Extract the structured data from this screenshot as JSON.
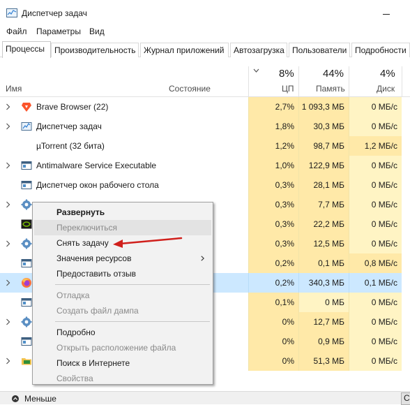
{
  "window": {
    "title": "Диспетчер задач"
  },
  "menu": [
    "Файл",
    "Параметры",
    "Вид"
  ],
  "tabs": [
    "Процессы",
    "Производительность",
    "Журнал приложений",
    "Автозагрузка",
    "Пользователи",
    "Подробности"
  ],
  "active_tab_index": 0,
  "header": {
    "name": "Имя",
    "status": "Состояние",
    "cpu_pct": "8%",
    "cpu": "ЦП",
    "mem_pct": "44%",
    "mem": "Память",
    "disk_pct": "4%",
    "disk": "Диск"
  },
  "rows": [
    {
      "name": "Brave Browser (22)",
      "cpu": "2,7%",
      "mem": "1 093,3 МБ",
      "disk": "0 МБ/с",
      "icon": "brave-icon",
      "expandable": true
    },
    {
      "name": "Диспетчер задач",
      "cpu": "1,8%",
      "mem": "30,3 МБ",
      "disk": "0 МБ/с",
      "icon": "task-manager-icon",
      "expandable": true
    },
    {
      "name": "µTorrent (32 бита)",
      "cpu": "1,2%",
      "mem": "98,7 МБ",
      "disk": "1,2 МБ/с",
      "icon": "utorrent-icon",
      "expandable": false
    },
    {
      "name": "Antimalware Service Executable",
      "cpu": "1,0%",
      "mem": "122,9 МБ",
      "disk": "0 МБ/с",
      "icon": "service-window-icon",
      "expandable": true
    },
    {
      "name": "Диспетчер окон рабочего стола",
      "cpu": "0,3%",
      "mem": "28,1 МБ",
      "disk": "0 МБ/с",
      "icon": "service-window-icon",
      "expandable": false
    },
    {
      "name": "",
      "cpu": "0,3%",
      "mem": "7,7 МБ",
      "disk": "0 МБ/с",
      "icon": "gear-icon",
      "expandable": true
    },
    {
      "name": "",
      "cpu": "0,3%",
      "mem": "22,2 МБ",
      "disk": "0 МБ/с",
      "icon": "nvidia-icon",
      "expandable": false
    },
    {
      "name": "",
      "cpu": "0,3%",
      "mem": "12,5 МБ",
      "disk": "0 МБ/с",
      "icon": "gear-icon",
      "expandable": true
    },
    {
      "name": "",
      "cpu": "0,2%",
      "mem": "0,1 МБ",
      "disk": "0,8 МБ/с",
      "icon": "service-window-icon",
      "expandable": false
    },
    {
      "name": "",
      "cpu": "0,2%",
      "mem": "340,3 МБ",
      "disk": "0,1 МБ/с",
      "icon": "firefox-icon",
      "expandable": true,
      "selected": true
    },
    {
      "name": "",
      "cpu": "0,1%",
      "mem": "0 МБ",
      "disk": "0 МБ/с",
      "icon": "service-window-icon",
      "expandable": false
    },
    {
      "name": "",
      "cpu": "0%",
      "mem": "12,7 МБ",
      "disk": "0 МБ/с",
      "icon": "gear-icon",
      "expandable": true
    },
    {
      "name": "",
      "cpu": "0%",
      "mem": "0,9 МБ",
      "disk": "0 МБ/с",
      "icon": "service-window-icon",
      "expandable": false
    },
    {
      "name": "",
      "cpu": "0%",
      "mem": "51,3 МБ",
      "disk": "0 МБ/с",
      "icon": "folder-icon",
      "expandable": true
    }
  ],
  "context_menu": {
    "items": [
      {
        "label": "Развернуть",
        "bold": true
      },
      {
        "label": "Переключиться",
        "disabled": true,
        "hover": true
      },
      {
        "label": "Снять задачу"
      },
      {
        "label": "Значения ресурсов",
        "submenu": true
      },
      {
        "label": "Предоставить отзыв"
      },
      {
        "separator": true
      },
      {
        "label": "Отладка",
        "disabled": true
      },
      {
        "label": "Создать файл дампа",
        "disabled": true
      },
      {
        "separator": true
      },
      {
        "label": "Подробно"
      },
      {
        "label": "Открыть расположение файла",
        "disabled": true
      },
      {
        "label": "Поиск в Интернете"
      },
      {
        "label": "Свойства",
        "disabled": true
      }
    ]
  },
  "footer": {
    "less_label": "Меньше",
    "end_task_label": "С"
  },
  "colors": {
    "heat_light": "#fff4c4",
    "heat_mid": "#ffe9a8",
    "selected_row": "#cce8ff",
    "annotation_arrow": "#d0201c"
  }
}
